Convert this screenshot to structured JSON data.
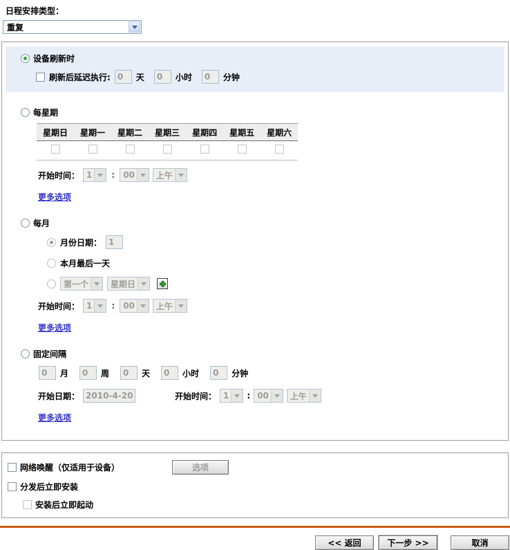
{
  "schedule": {
    "type_label": "日程安排类型：",
    "type_value": "重复"
  },
  "device_refresh": {
    "label": "设备刷新时",
    "delay_label": "刷新后延迟执行:",
    "days_value": "0",
    "days_unit": "天",
    "hours_value": "0",
    "hours_unit": "小时",
    "minutes_value": "0",
    "minutes_unit": "分钟"
  },
  "weekly": {
    "label": "每星期",
    "days": [
      "星期日",
      "星期一",
      "星期二",
      "星期三",
      "星期四",
      "星期五",
      "星期六"
    ]
  },
  "monthly": {
    "label": "每月",
    "day_of_month_label": "月份日期：",
    "day_of_month_value": "1",
    "last_day_label": "本月最后一天",
    "ordinal_value": "第一个",
    "weekday_value": "星期日"
  },
  "interval": {
    "label": "固定间隔",
    "fields": [
      {
        "value": "0",
        "unit": "月"
      },
      {
        "value": "0",
        "unit": "周"
      },
      {
        "value": "0",
        "unit": "天"
      },
      {
        "value": "0",
        "unit": "小时"
      },
      {
        "value": "0",
        "unit": "分钟"
      }
    ],
    "start_date_label": "开始日期：",
    "start_date_value": "2010-4-20"
  },
  "time": {
    "start_label": "开始时间：",
    "hour": "1",
    "separator": ":",
    "minute": "00",
    "meridiem": "上午"
  },
  "links": {
    "more_options": "更多选项"
  },
  "options_panel": {
    "wake_on_lan_label": "网络唤醒（仅适用于设备）",
    "options_button": "选项",
    "install_now_label": "分发后立即安装",
    "launch_now_label": "安装后立即起动"
  },
  "actions": {
    "back": "<< 返回",
    "next": "下一步 >>",
    "cancel": "取消"
  },
  "colors": {
    "accent_rule": "#C95B16",
    "highlight_bg": "#E7EEF7",
    "link": "#3333CC"
  }
}
